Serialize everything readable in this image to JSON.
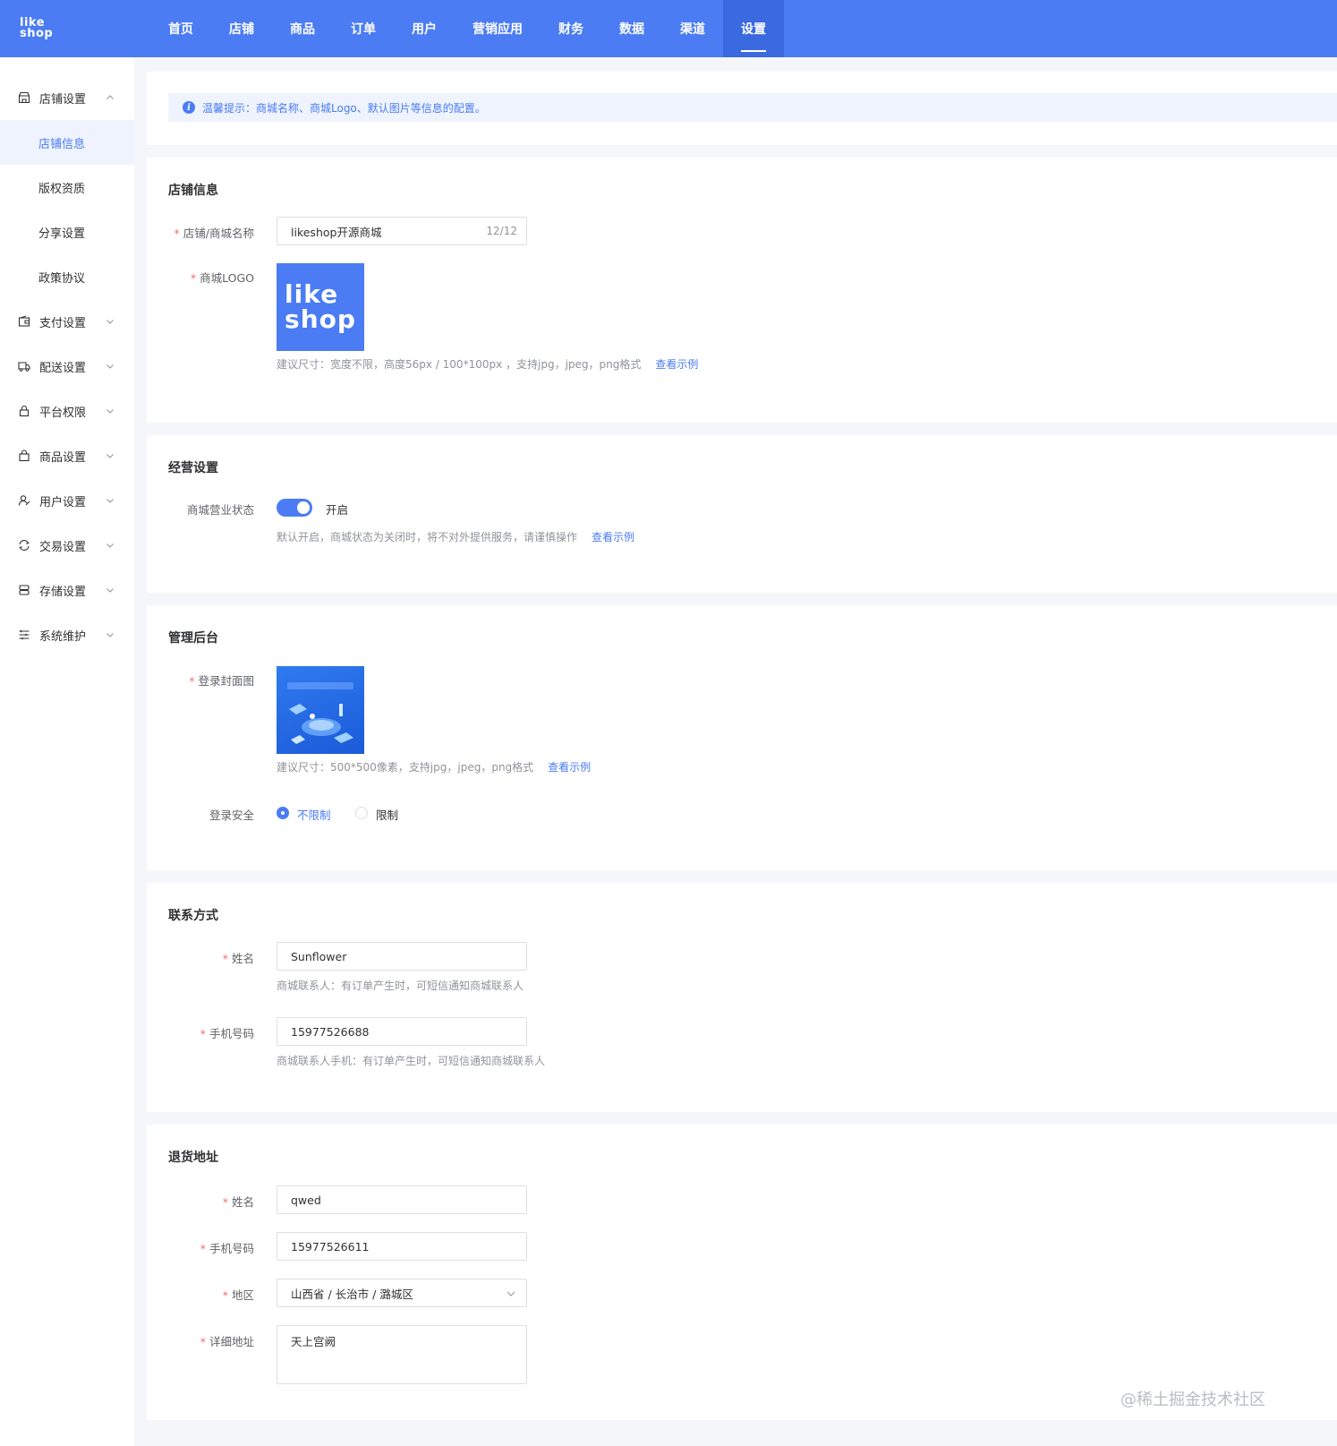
{
  "brand": {
    "logo_line1": "like",
    "logo_line2": "shop"
  },
  "nav": {
    "items": [
      "首页",
      "店铺",
      "商品",
      "订单",
      "用户",
      "营销应用",
      "财务",
      "数据",
      "渠道",
      "设置"
    ],
    "active": "设置"
  },
  "sidebar": {
    "groups": [
      {
        "label": "店铺设置",
        "icon": "shop-icon",
        "expanded": true,
        "children": [
          "店铺信息",
          "版权资质",
          "分享设置",
          "政策协议"
        ],
        "active_child": "店铺信息"
      },
      {
        "label": "支付设置",
        "icon": "wallet-icon"
      },
      {
        "label": "配送设置",
        "icon": "truck-icon"
      },
      {
        "label": "平台权限",
        "icon": "lock-icon"
      },
      {
        "label": "商品设置",
        "icon": "bag-icon"
      },
      {
        "label": "用户设置",
        "icon": "user-icon"
      },
      {
        "label": "交易设置",
        "icon": "exchange-icon"
      },
      {
        "label": "存储设置",
        "icon": "storage-icon"
      },
      {
        "label": "系统维护",
        "icon": "list-icon"
      }
    ]
  },
  "tip": {
    "text": "温馨提示：商城名称、商城Logo、默认图片等信息的配置。"
  },
  "shop_info": {
    "title": "店铺信息",
    "name_label": "店铺/商城名称",
    "name_value": "likeshop开源商城",
    "name_count": "12/12",
    "logo_label": "商城LOGO",
    "logo_text_line1": "like",
    "logo_text_line2": "shop",
    "logo_help": "建议尺寸：宽度不限，高度56px / 100*100px ，支持jpg，jpeg，png格式",
    "logo_link": "查看示例"
  },
  "business": {
    "title": "经营设置",
    "status_label": "商城营业状态",
    "status_value": "开启",
    "status_on": true,
    "status_help": "默认开启，商城状态为关闭时，将不对外提供服务，请谨慎操作",
    "status_link": "查看示例"
  },
  "admin": {
    "title": "管理后台",
    "cover_label": "登录封面图",
    "cover_help": "建议尺寸：500*500像素，支持jpg，jpeg，png格式",
    "cover_link": "查看示例",
    "security_label": "登录安全",
    "security_options": [
      "不限制",
      "限制"
    ],
    "security_selected": "不限制"
  },
  "contact": {
    "title": "联系方式",
    "name_label": "姓名",
    "name_value": "Sunflower",
    "name_help": "商城联系人：有订单产生时，可短信通知商城联系人",
    "phone_label": "手机号码",
    "phone_value": "15977526688",
    "phone_help": "商城联系人手机：有订单产生时，可短信通知商城联系人"
  },
  "return_address": {
    "title": "退货地址",
    "name_label": "姓名",
    "name_value": "qwed",
    "phone_label": "手机号码",
    "phone_value": "15977526611",
    "region_label": "地区",
    "region_value": "山西省 / 长治市 / 潞城区",
    "address_label": "详细地址",
    "address_value": "天上宫阙"
  },
  "watermark": "@稀土掘金技术社区",
  "colors": {
    "primary": "#4b7cf3",
    "required": "#f56c6c",
    "text_muted": "#909399"
  }
}
